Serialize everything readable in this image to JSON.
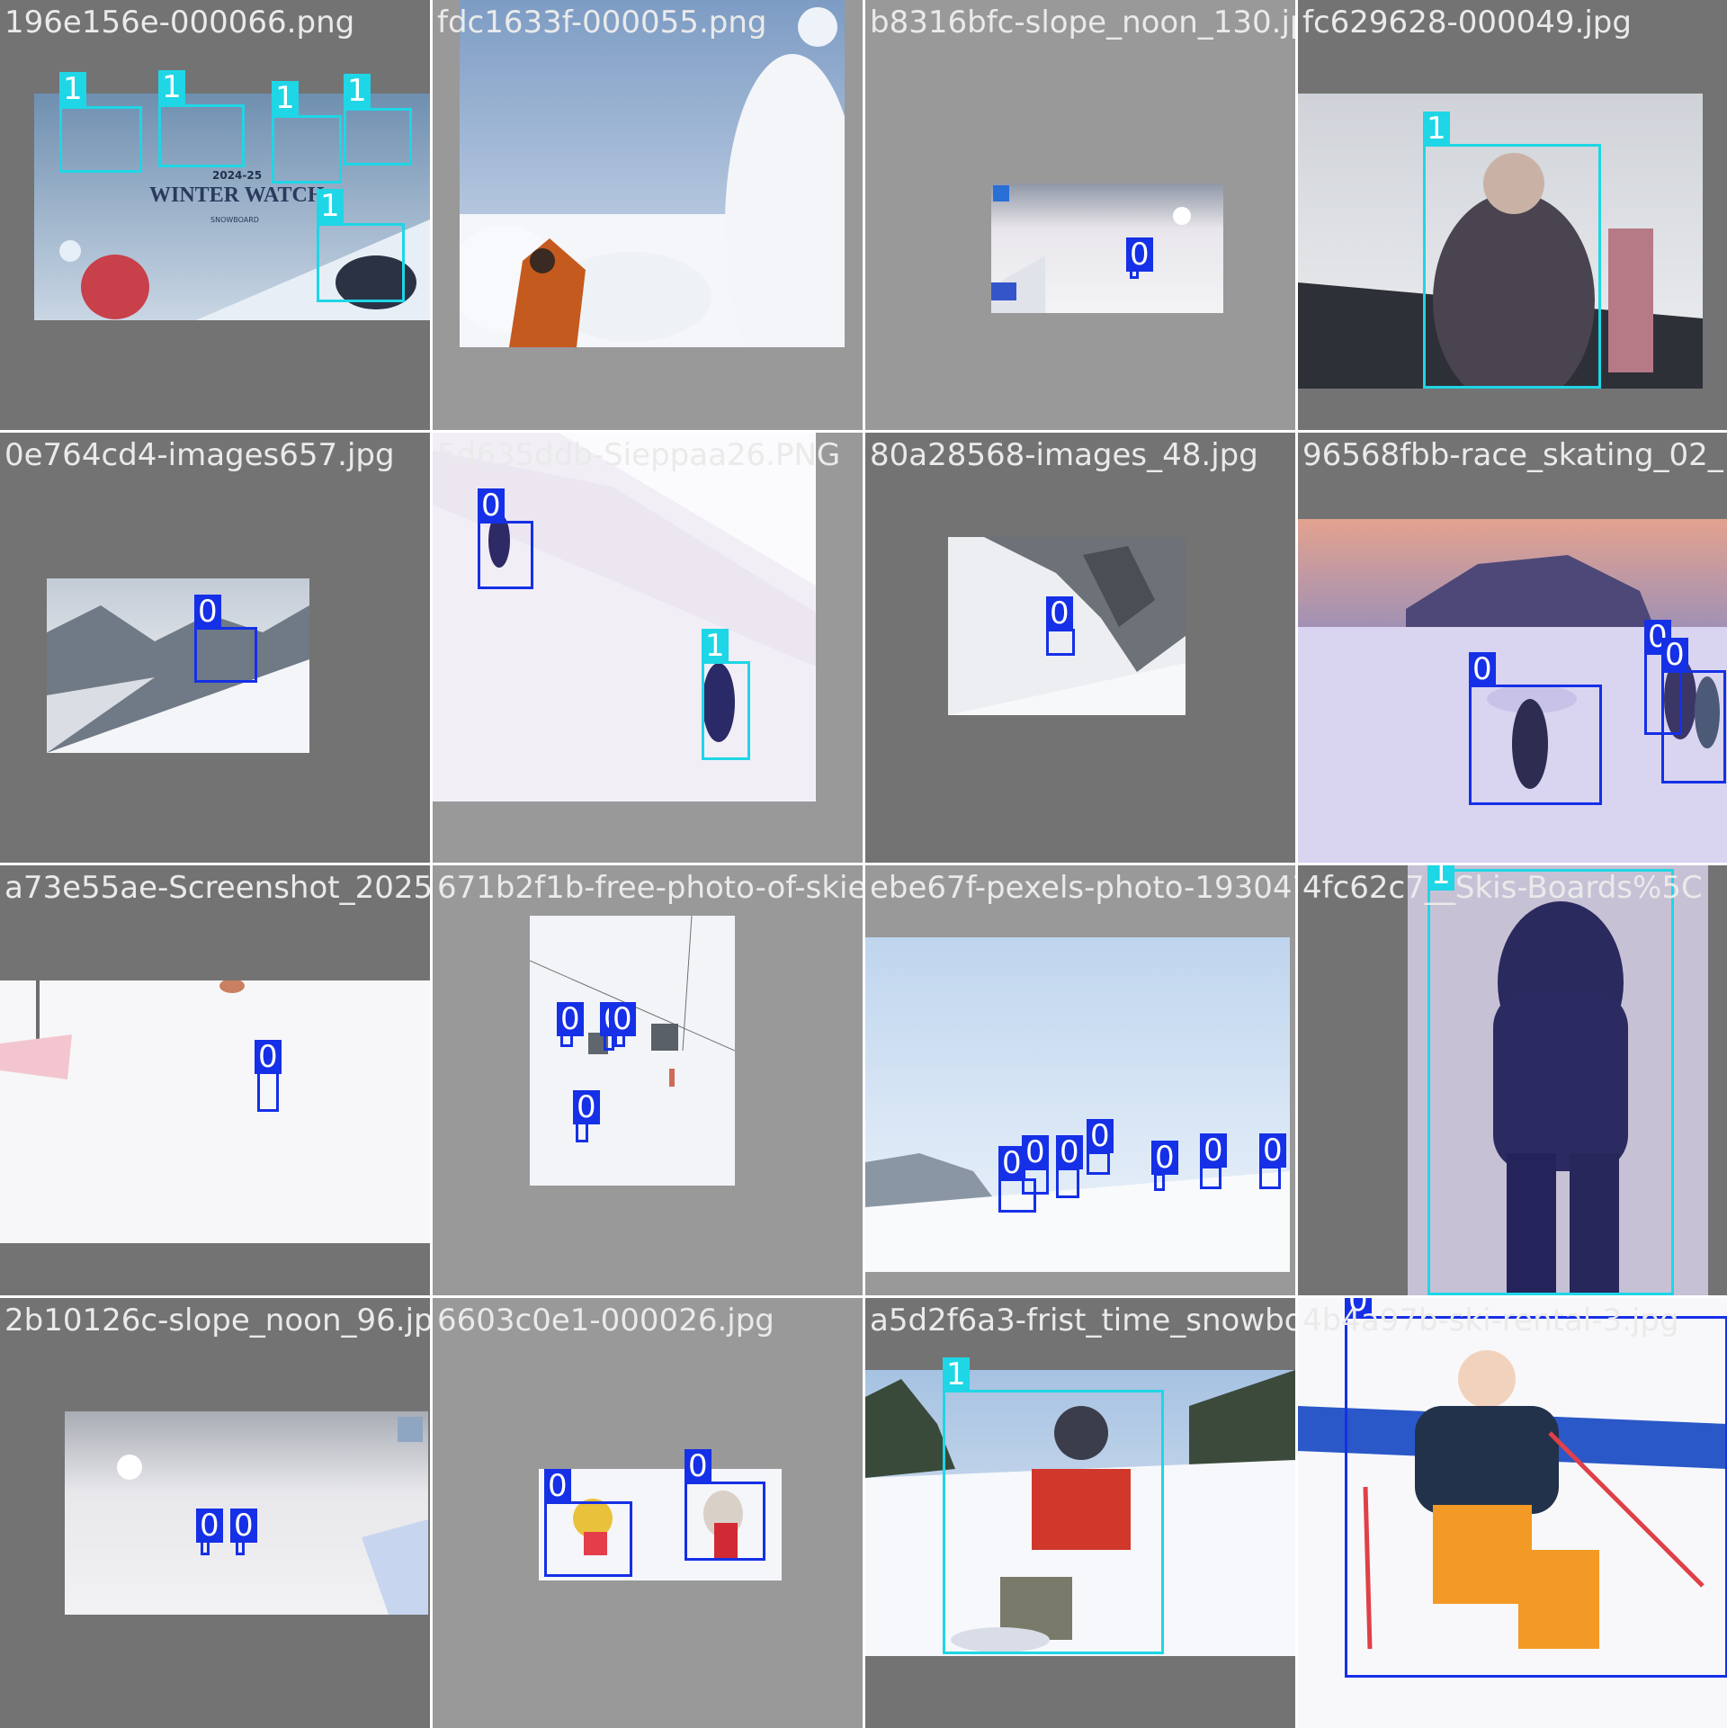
{
  "colors": {
    "class0": "#1530e6",
    "class1": "#1ed6e6",
    "bg_dark": "#737373",
    "bg_light": "#999999"
  },
  "tiles": [
    {
      "filename": "196e156e-000066.png",
      "labels": [
        "1",
        "1",
        "1",
        "1",
        "1"
      ],
      "caption": "2024-25",
      "title": "WINTER WATCH",
      "subtitle": "SNOWBOARD"
    },
    {
      "filename": "fdc1633f-000055.png",
      "labels": []
    },
    {
      "filename": "b8316bfc-slope_noon_130.jpg",
      "labels": [
        "0"
      ]
    },
    {
      "filename": "fc629628-000049.jpg",
      "labels": [
        "1"
      ]
    },
    {
      "filename": "0e764cd4-images657.jpg",
      "labels": [
        "0"
      ]
    },
    {
      "filename": "5d635ddb-Sieppaa26.PNG",
      "labels": [
        "0",
        "1"
      ]
    },
    {
      "filename": "80a28568-images_48.jpg",
      "labels": [
        "0"
      ]
    },
    {
      "filename": "96568fbb-race_skating_02_",
      "labels": [
        "0",
        "0",
        "0"
      ]
    },
    {
      "filename": "a73e55ae-Screenshot_2025-03-02_133259",
      "labels": [
        "0"
      ]
    },
    {
      "filename": "671b2f1b-free-photo-of-skiers-descending",
      "labels": [
        "0",
        "0",
        "0",
        "0"
      ]
    },
    {
      "filename": "ebe67f-pexels-photo-19304766",
      "labels": [
        "0",
        "0",
        "0",
        "0",
        "0",
        "0",
        "0"
      ]
    },
    {
      "filename": "4fc62c7__Skis-Boards%5C",
      "labels": [
        "1"
      ]
    },
    {
      "filename": "2b10126c-slope_noon_96.jpg",
      "labels": [
        "0",
        "0"
      ]
    },
    {
      "filename": "6603c0e1-000026.jpg",
      "labels": [
        "0",
        "0"
      ]
    },
    {
      "filename": "a5d2f6a3-frist_time_snowboard",
      "labels": [
        "1"
      ]
    },
    {
      "filename": "4b4a97b-ski-rental-3.jpg",
      "labels": [
        "0"
      ]
    }
  ]
}
